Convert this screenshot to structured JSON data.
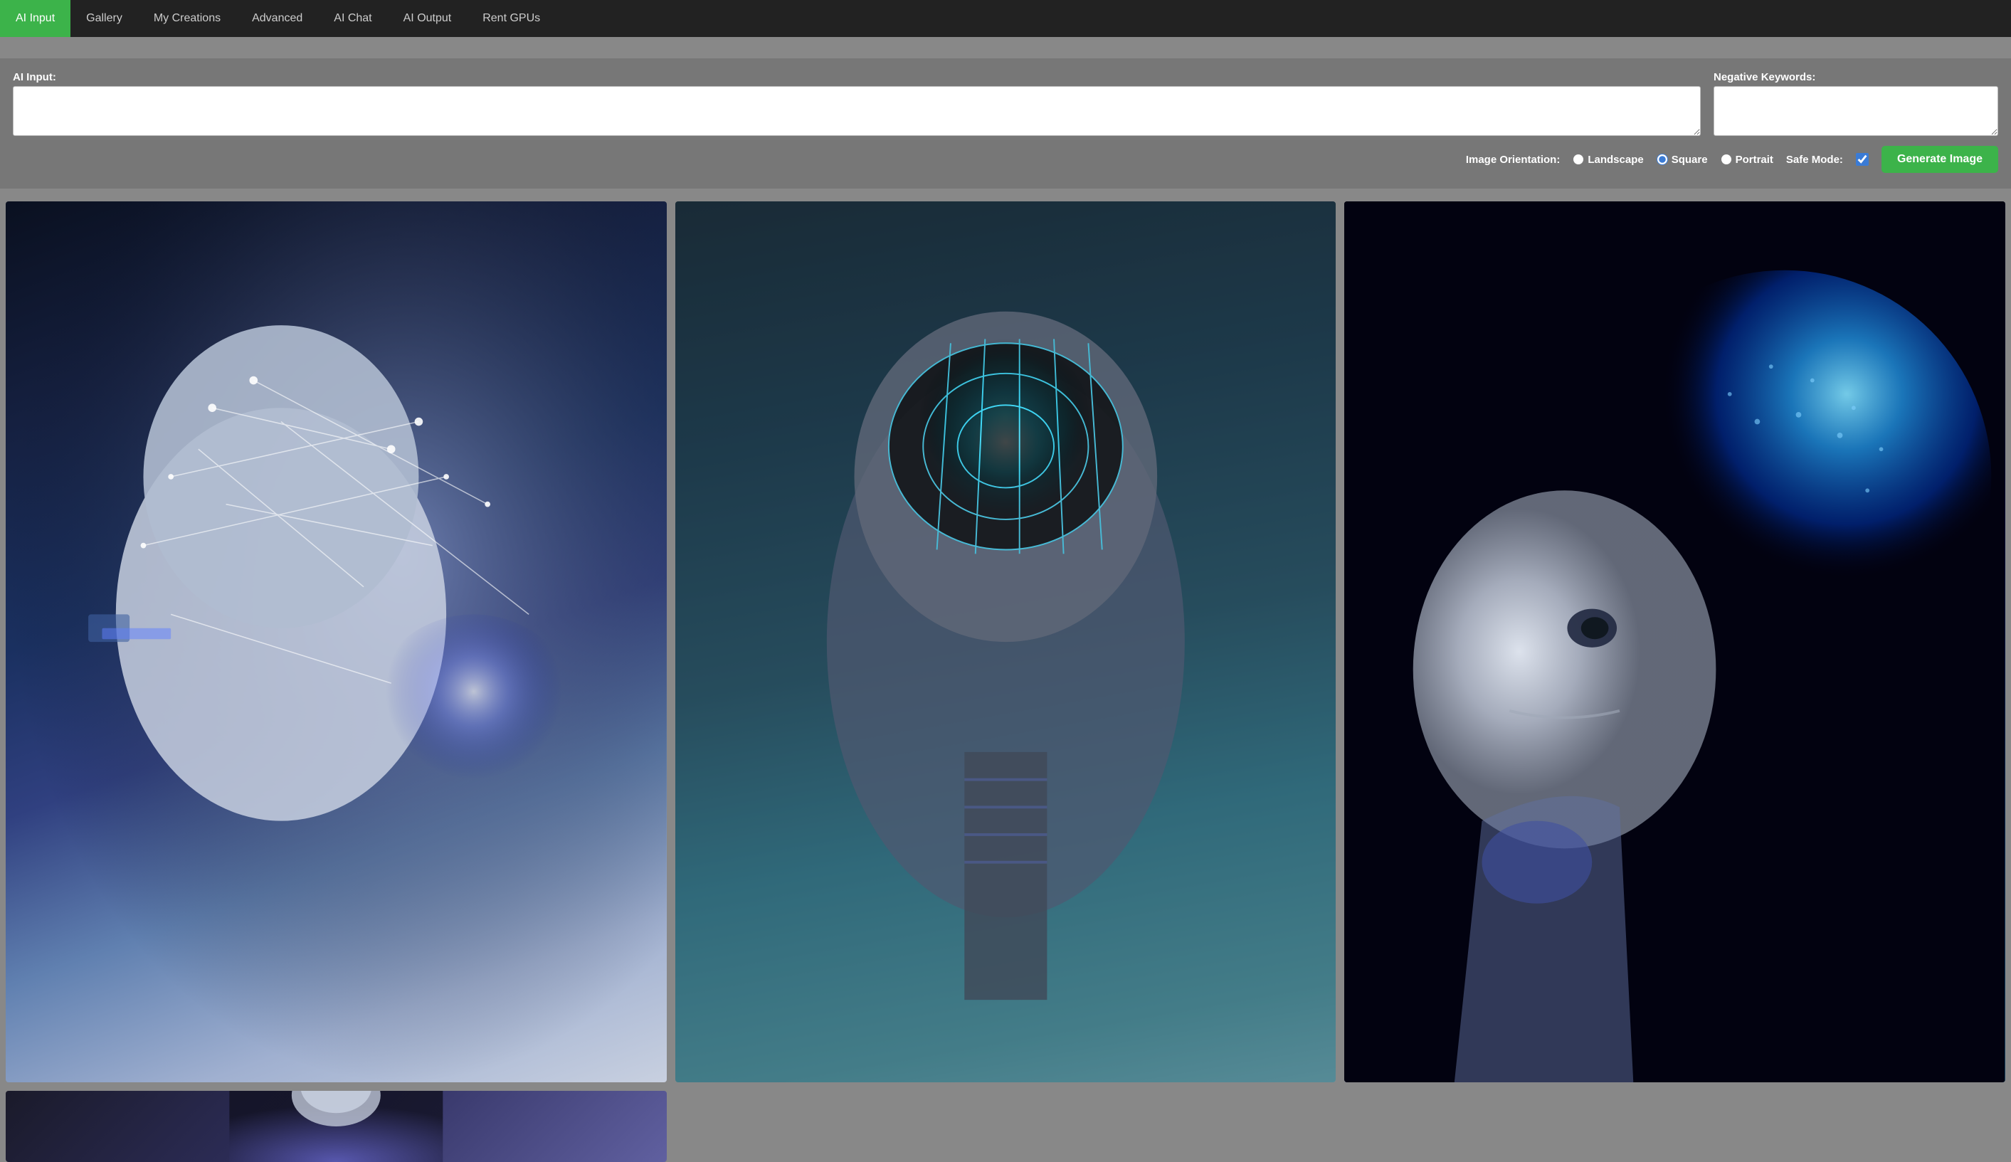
{
  "nav": {
    "items": [
      {
        "label": "AI Input",
        "active": true
      },
      {
        "label": "Gallery",
        "active": false
      },
      {
        "label": "My Creations",
        "active": false
      },
      {
        "label": "Advanced",
        "active": false
      },
      {
        "label": "AI Chat",
        "active": false
      },
      {
        "label": "AI Output",
        "active": false
      },
      {
        "label": "Rent GPUs",
        "active": false
      }
    ]
  },
  "input_section": {
    "ai_input_label": "AI Input:",
    "negative_keywords_label": "Negative Keywords:",
    "ai_input_placeholder": "",
    "negative_keywords_placeholder": ""
  },
  "controls": {
    "orientation_label": "Image Orientation:",
    "orientation_options": [
      {
        "label": "Landscape",
        "value": "landscape",
        "checked": false
      },
      {
        "label": "Square",
        "value": "square",
        "checked": true
      },
      {
        "label": "Portrait",
        "value": "portrait",
        "checked": false
      }
    ],
    "safe_mode_label": "Safe Mode:",
    "safe_mode_checked": true,
    "generate_button_label": "Generate Image"
  },
  "gallery": {
    "images": [
      {
        "alt": "AI robot head with neural network visualization, blue tones",
        "id": "img1"
      },
      {
        "alt": "AI robot head with glowing brain visualization, teal background",
        "id": "img2"
      },
      {
        "alt": "AI robot face with glowing blue sphere, dark background",
        "id": "img3"
      },
      {
        "alt": "AI robot partial view at bottom",
        "id": "img4"
      }
    ]
  }
}
